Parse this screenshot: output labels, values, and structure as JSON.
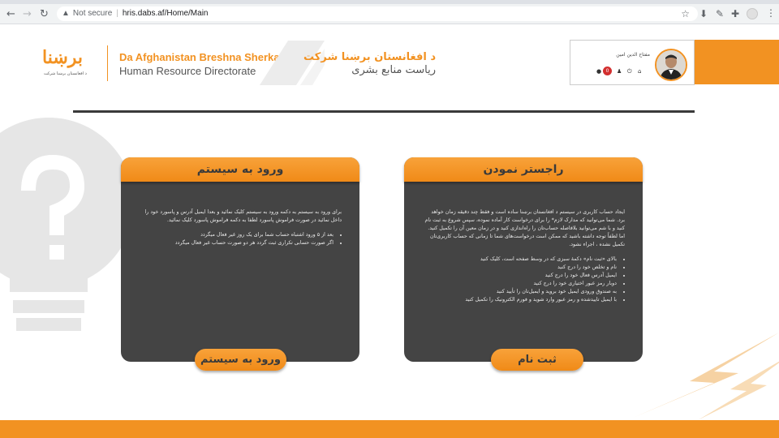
{
  "browser": {
    "security_label": "Not secure",
    "url": "hris.dabs.af/Home/Main"
  },
  "header": {
    "logo_text": "برښنا",
    "logo_subtext": "د افغانستان برښنا شرکت",
    "english_title": "Da Afghanistan Breshna Sherkat",
    "english_subtitle": "Human Resource Directorate",
    "pashto_title": "د افغانستان برښنا شرکت",
    "pashto_subtitle": "ریاست منابع بشری"
  },
  "user": {
    "name": "مفتاح الدین امین",
    "notification_count": "0"
  },
  "login_card": {
    "title": "ورود به سیستم",
    "intro": "برای ورود به سیستم به دکمه ورود به سیستم کلیک نمائید و بعدا ایمیل آدرس و پاسورد خود را داخل نمائید در صورت فراموش پاسورد لطفا به دکمه فراموش پاسورد کلیک نمائید.",
    "bullets": [
      "بعد از ۵ ورود اشتباه حساب شما برای یک روز غیر فعال میگردد",
      "اگر صورت حسابی تکراری ثبت گردد هر دو صورت حساب غیر فعال میگردد"
    ],
    "button_label": "ورود به سیستم"
  },
  "register_card": {
    "title": "راجستر نمودن",
    "intro": "ایجاد حساب کاربری در سیستم د افغانستان برښنا ساده است و فقط چند دقیقه زمان خواهد برد. شما می‌توانید که مدارک لازم* را برای درخواست کار آماده نموده، سپس شروع به ثبت نام کنید و با شم می‌توانید بلافاصله حساب‌تان را راه‌اندازی کنید و در زمان معین آن را تکمیل کنید. اما لطفاً توجه داشته باشید که ممکن است درخواست‌های شما تا زمانی که حساب کاربری‌تان تکمیل نشده ، اجراء نشود.",
    "bullets": [
      "بالای «ثبت نام» دکمۀ سبزی که در وسط صفحه است، کلیک کنید",
      "نام و تخلص خود را درج کنید",
      "ایمیل آدرس فعال خود را درج کنید",
      "دوبار رمز عبور اختیاری خود را درج کنید",
      "به صندوق ورودی ایمیل خود بروید و ایمیل‌تان را تأیید کنید",
      "با ایمیل تاییدشده و رمز عبور وارد شوید و فورم الکترونیک را تکمیل کنید"
    ],
    "button_label": "ثبت نام"
  },
  "colors": {
    "accent": "#f29222",
    "card_bg": "#444444",
    "rule": "#3a3a3a"
  }
}
